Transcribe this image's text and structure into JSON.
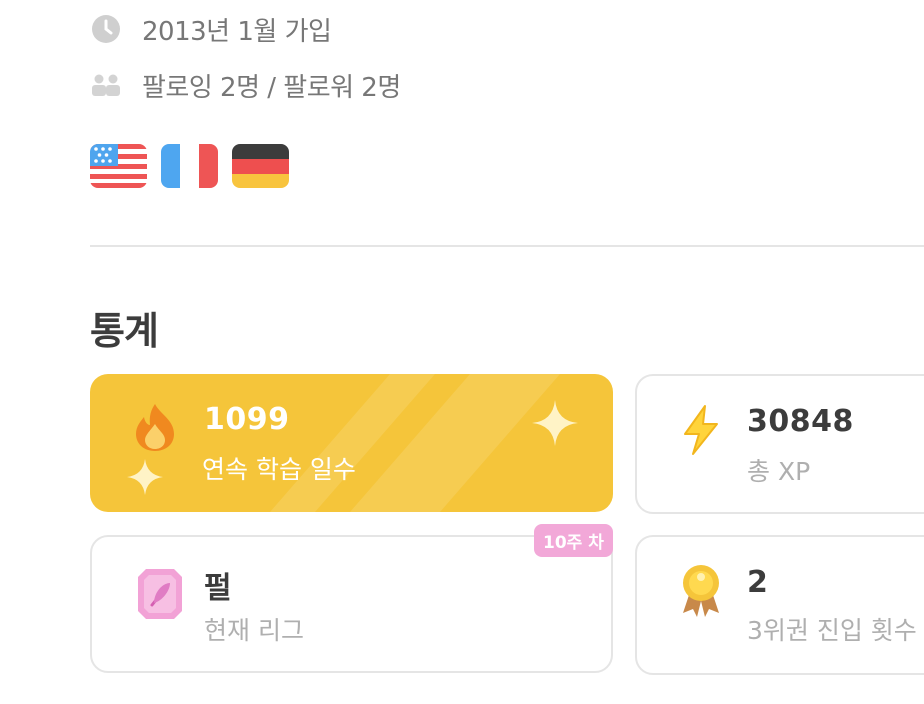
{
  "profile": {
    "joined": "2013년 1월 가입",
    "follow": "팔로잉 2명 / 팔로워 2명",
    "flags": [
      {
        "name": "us-flag-icon"
      },
      {
        "name": "fr-flag-icon"
      },
      {
        "name": "de-flag-icon"
      }
    ]
  },
  "stats": {
    "title": "통계",
    "cards": [
      {
        "value": "1099",
        "label": "연속 학습 일수",
        "icon": "flame-icon"
      },
      {
        "value": "30848",
        "label": "총 XP",
        "icon": "lightning-icon"
      },
      {
        "value": "펄",
        "label": "현재 리그",
        "icon": "pearl-league-icon",
        "badge": "10주 차"
      },
      {
        "value": "2",
        "label": "3위권 진입 횟수",
        "icon": "medal-icon"
      }
    ]
  },
  "colors": {
    "streak_bg": "#f5c53a",
    "badge_bg": "#f2a8d8",
    "muted_text": "#777777"
  }
}
